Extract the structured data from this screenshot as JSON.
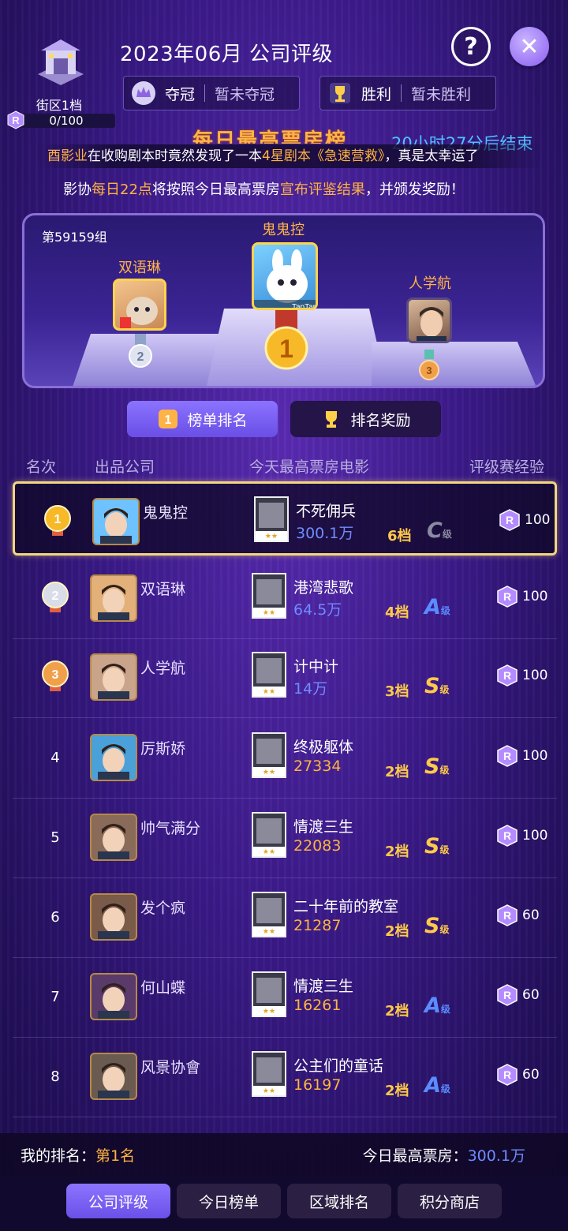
{
  "header": {
    "title": "2023年06月 公司评级",
    "district": {
      "name": "街区1档",
      "progress_text": "0/100",
      "progress": 0
    },
    "crown": {
      "label": "夺冠",
      "value": "暂未夺冠"
    },
    "win": {
      "label": "胜利",
      "value": "暂未胜利"
    },
    "help_icon": "question-icon",
    "close_icon": "close-icon"
  },
  "banner": {
    "title": "每日最高票房榜",
    "countdown": "20小时27分后结束",
    "news_prefix": "酉影业",
    "news_mid": "在收购剧本时竟然发现了一本",
    "news_highlight": "4星剧本《急速营救》",
    "news_suffix": "，真是太幸运了",
    "notice_a": "影协",
    "notice_b": "每日22点",
    "notice_c": "将按照今日最高票房",
    "notice_d": "宣布评鉴结果",
    "notice_e": "，并颁发奖励！"
  },
  "podium": {
    "group": "第59159组",
    "first": "鬼鬼控",
    "second": "双语琳",
    "third": "人学航"
  },
  "tabs": {
    "ranking": "榜单排名",
    "rewards": "排名奖励"
  },
  "columns": {
    "rank": "名次",
    "company": "出品公司",
    "movie": "今天最高票房电影",
    "exp": "评级赛经验"
  },
  "rows": [
    {
      "rank": "1",
      "company": "鬼鬼控",
      "movie": "不死佣兵",
      "box": "300.1万",
      "tier": "6档",
      "grade": "C",
      "grade_suffix": "级",
      "exp": "100"
    },
    {
      "rank": "2",
      "company": "双语琳",
      "movie": "港湾悲歌",
      "box": "64.5万",
      "tier": "4档",
      "grade": "A",
      "grade_suffix": "级",
      "exp": "100"
    },
    {
      "rank": "3",
      "company": "人学航",
      "movie": "计中计",
      "box": "14万",
      "tier": "3档",
      "grade": "S",
      "grade_suffix": "级",
      "exp": "100"
    },
    {
      "rank": "4",
      "company": "厉斯娇",
      "movie": "终极躯体",
      "box": "27334",
      "tier": "2档",
      "grade": "S",
      "grade_suffix": "级",
      "exp": "100"
    },
    {
      "rank": "5",
      "company": "帅气满分",
      "movie": "情渡三生",
      "box": "22083",
      "tier": "2档",
      "grade": "S",
      "grade_suffix": "级",
      "exp": "100"
    },
    {
      "rank": "6",
      "company": "发个疯",
      "movie": "二十年前的教室",
      "box": "21287",
      "tier": "2档",
      "grade": "S",
      "grade_suffix": "级",
      "exp": "60"
    },
    {
      "rank": "7",
      "company": "何山蝶",
      "movie": "情渡三生",
      "box": "16261",
      "tier": "2档",
      "grade": "A",
      "grade_suffix": "级",
      "exp": "60"
    },
    {
      "rank": "8",
      "company": "风景协會",
      "movie": "公主们的童话",
      "box": "16197",
      "tier": "2档",
      "grade": "A",
      "grade_suffix": "级",
      "exp": "60"
    }
  ],
  "footer": {
    "my_rank_label": "我的排名：",
    "my_rank_value": "第1名",
    "box_label": "今日最高票房：",
    "box_value": "300.1万"
  },
  "nav": {
    "company_rating": "公司评级",
    "today_list": "今日榜单",
    "region_rank": "区域排名",
    "points_shop": "积分商店"
  },
  "colors": {
    "accent": "#7c62f5",
    "gold": "#ffb347",
    "box_blue": "#6f8cff",
    "box_orange": "#ffb340",
    "grade_s": "#ffc94a",
    "grade_a": "#5a8cff",
    "grade_c": "#8a8aa0"
  }
}
